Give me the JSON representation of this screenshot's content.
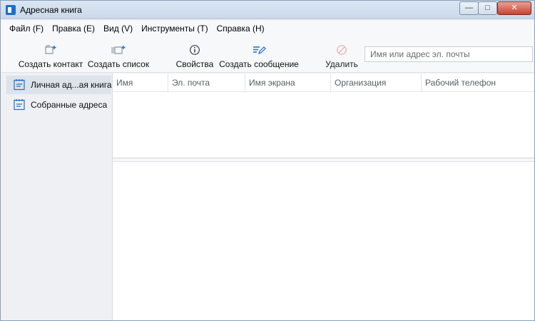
{
  "window": {
    "title": "Адресная книга",
    "minimize": "—",
    "maximize": "□",
    "close": "✕"
  },
  "menu": [
    {
      "label": "Файл (F)"
    },
    {
      "label": "Правка (E)"
    },
    {
      "label": "Вид (V)"
    },
    {
      "label": "Инструменты (T)"
    },
    {
      "label": "Справка (H)"
    }
  ],
  "toolbar": {
    "new_contact": "Создать контакт",
    "new_list": "Создать список",
    "properties": "Свойства",
    "new_message": "Создать сообщение",
    "delete": "Удалить",
    "search_placeholder": "Имя или адрес эл. почты"
  },
  "sidebar": {
    "items": [
      {
        "label": "Личная ад...ая книга",
        "icon": "address-book-icon",
        "selected": true
      },
      {
        "label": "Собранные адреса",
        "icon": "address-book-icon",
        "selected": false
      }
    ]
  },
  "table": {
    "columns": [
      "Имя",
      "Эл. почта",
      "Имя экрана",
      "Организация",
      "Рабочий телефон"
    ]
  },
  "colors": {
    "accent": "#1b6fc8",
    "icon_gray": "#8c96a3",
    "close_red": "#c7442f"
  }
}
